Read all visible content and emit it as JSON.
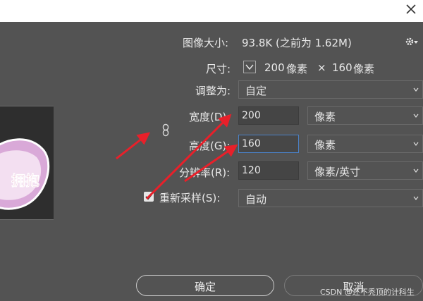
{
  "dialog": {
    "image_size_label": "图像大小:",
    "image_size_value": "93.8K (之前为 1.62M)",
    "dimensions_label": "尺寸:",
    "dimensions_w": "200",
    "dimensions_w_unit": "像素",
    "dimensions_times": "×",
    "dimensions_h": "160",
    "dimensions_h_unit": "像素",
    "fit_to_label": "调整为:",
    "fit_to_value": "自定",
    "width_label": "宽度(D):",
    "width_value": "200",
    "width_unit": "像素",
    "height_label": "高度(G):",
    "height_value": "160",
    "height_unit": "像素",
    "resolution_label": "分辨率(R):",
    "resolution_value": "120",
    "resolution_unit": "像素/英寸",
    "resample_label": "重新采样(S):",
    "resample_value": "自动",
    "resample_checked": true,
    "ok_label": "确定",
    "cancel_label": "取消"
  },
  "preview": {
    "text": "拥抱"
  },
  "watermark": "CSDN @还不秃顶的计科生",
  "icons": [
    "close-icon",
    "gear-icon",
    "chevron-down-icon",
    "link-icon",
    "checkmark-icon"
  ],
  "colors": {
    "panel": "#535353",
    "arrow": "#e8202a",
    "focus": "#4a82c8"
  }
}
